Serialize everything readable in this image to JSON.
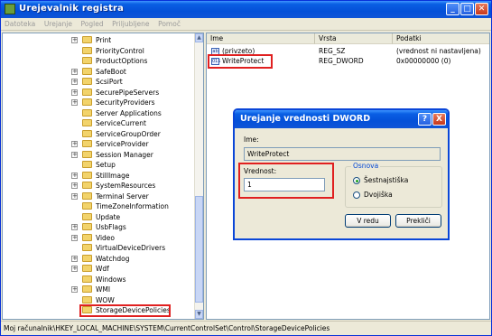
{
  "window": {
    "title": "Urejevalnik registra"
  },
  "menu": [
    "Datoteka",
    "Urejanje",
    "Pogled",
    "Priljubljene",
    "Pomoč"
  ],
  "tree": {
    "items": [
      {
        "label": "Print",
        "expander": "+"
      },
      {
        "label": "PriorityControl",
        "expander": ""
      },
      {
        "label": "ProductOptions",
        "expander": ""
      },
      {
        "label": "SafeBoot",
        "expander": "+"
      },
      {
        "label": "ScsiPort",
        "expander": "+"
      },
      {
        "label": "SecurePipeServers",
        "expander": "+"
      },
      {
        "label": "SecurityProviders",
        "expander": "+"
      },
      {
        "label": "Server Applications",
        "expander": ""
      },
      {
        "label": "ServiceCurrent",
        "expander": ""
      },
      {
        "label": "ServiceGroupOrder",
        "expander": ""
      },
      {
        "label": "ServiceProvider",
        "expander": "+"
      },
      {
        "label": "Session Manager",
        "expander": "+"
      },
      {
        "label": "Setup",
        "expander": ""
      },
      {
        "label": "StillImage",
        "expander": "+"
      },
      {
        "label": "SystemResources",
        "expander": "+"
      },
      {
        "label": "Terminal Server",
        "expander": "+"
      },
      {
        "label": "TimeZoneInformation",
        "expander": ""
      },
      {
        "label": "Update",
        "expander": ""
      },
      {
        "label": "UsbFlags",
        "expander": "+"
      },
      {
        "label": "Video",
        "expander": "+"
      },
      {
        "label": "VirtualDeviceDrivers",
        "expander": ""
      },
      {
        "label": "Watchdog",
        "expander": "+"
      },
      {
        "label": "Wdf",
        "expander": "+"
      },
      {
        "label": "Windows",
        "expander": ""
      },
      {
        "label": "WMI",
        "expander": "+"
      },
      {
        "label": "WOW",
        "expander": ""
      },
      {
        "label": "StorageDevicePolicies",
        "expander": ""
      }
    ]
  },
  "list": {
    "columns": [
      "Ime",
      "Vrsta",
      "Podatki"
    ],
    "rows": [
      {
        "name": "(privzeto)",
        "type": "REG_SZ",
        "data": "(vrednost ni nastavljena)",
        "icon": "ab"
      },
      {
        "name": "WriteProtect",
        "type": "REG_DWORD",
        "data": "0x00000000 (0)",
        "icon": "011"
      }
    ]
  },
  "dialog": {
    "title": "Urejanje vrednosti DWORD",
    "name_label": "Ime:",
    "name_value": "WriteProtect",
    "value_label": "Vrednost:",
    "value_value": "1",
    "base_label": "Osnova",
    "radio_hex": "Šestnajstiška",
    "radio_dec": "Dvojiška",
    "ok": "V redu",
    "cancel": "Prekliči",
    "help_btn": "?",
    "close_btn": "X"
  },
  "status": "Moj računalnik\\HKEY_LOCAL_MACHINE\\SYSTEM\\CurrentControlSet\\Control\\StorageDevicePolicies",
  "colors": {
    "highlight": "#e02020",
    "xp_blue": "#0450d8"
  }
}
